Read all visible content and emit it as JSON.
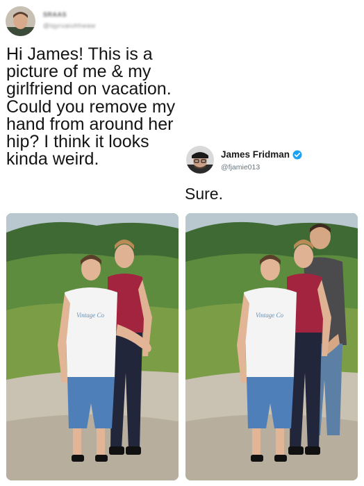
{
  "original_tweet": {
    "author_name": "SRAAS",
    "author_handle": "@lqyruaiuhhwaw",
    "text": "Hi James! This is a picture of me & my girlfriend on vacation. Could you remove my hand from around her hip? I think it looks kinda weird."
  },
  "reply_tweet": {
    "author_name": "James Fridman",
    "author_handle": "@fjamie013",
    "verified": true,
    "text": "Sure."
  },
  "photos": {
    "before": {
      "shirt_print": "Vintage Co"
    },
    "after": {
      "shirt_print": "Vintage Co"
    }
  },
  "colors": {
    "verified_blue": "#1da1f2",
    "text": "#141414",
    "handle_gray": "#66757f"
  }
}
